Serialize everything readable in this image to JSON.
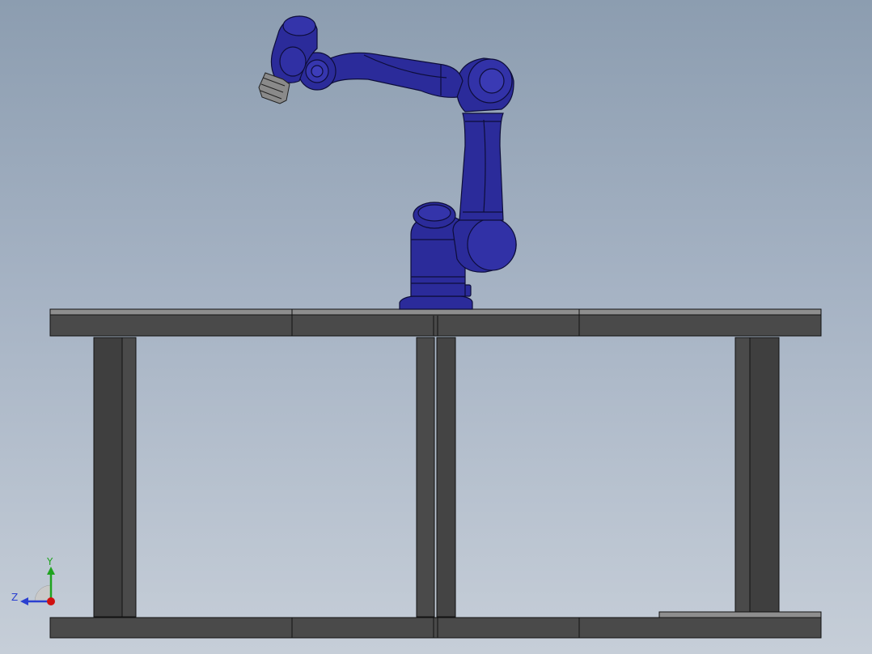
{
  "viewport": {
    "background_top": "#8c9db0",
    "background_bottom": "#c6ced8"
  },
  "model": {
    "robot_color": "#2b2b9a",
    "robot_outline": "#0d0d3a",
    "tool_color": "#8a8a8a",
    "table_color": "#4a4a4a",
    "table_top_highlight": "#8e8e8e"
  },
  "triad": {
    "y_label": "Y",
    "z_label": "Z",
    "y_color": "#1fa31f",
    "z_color": "#2a3fd0",
    "x_color": "#d01010"
  }
}
